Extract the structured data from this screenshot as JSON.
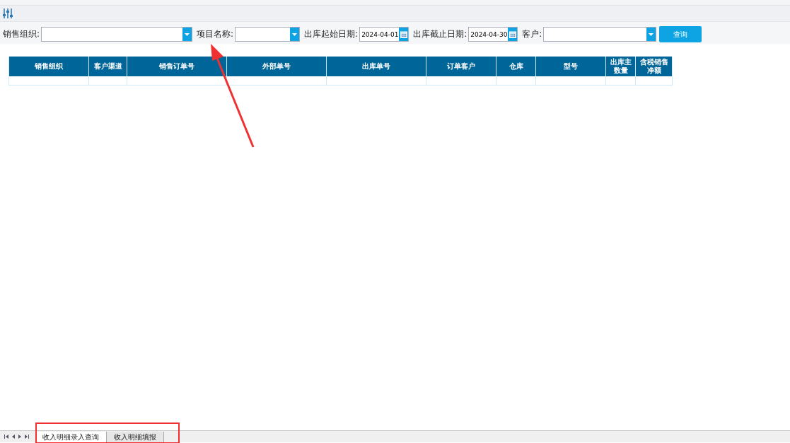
{
  "filters": [
    {
      "kind": "combo",
      "label": "销售组织:"
    },
    {
      "kind": "combo",
      "label": "项目名称:"
    },
    {
      "kind": "date",
      "label": "出库起始日期:",
      "value": "2024-04-01"
    },
    {
      "kind": "date",
      "label": "出库截止日期:",
      "value": "2024-04-30"
    },
    {
      "kind": "combo",
      "label": "客户:"
    }
  ],
  "query_button": "查询",
  "table": {
    "columns": [
      {
        "label": "销售组织"
      },
      {
        "label": "客户渠道"
      },
      {
        "label": "销售订单号"
      },
      {
        "label": "外部单号"
      },
      {
        "label": "出库单号"
      },
      {
        "label": "订单客户"
      },
      {
        "label": "仓库"
      },
      {
        "label": "型号"
      },
      {
        "label": "出库主数量"
      },
      {
        "label": "含税销售净额"
      }
    ]
  },
  "sheet_tabs": [
    {
      "label": "收入明细录入查询",
      "selected": true
    },
    {
      "label": "收入明细填报",
      "selected": false
    }
  ]
}
